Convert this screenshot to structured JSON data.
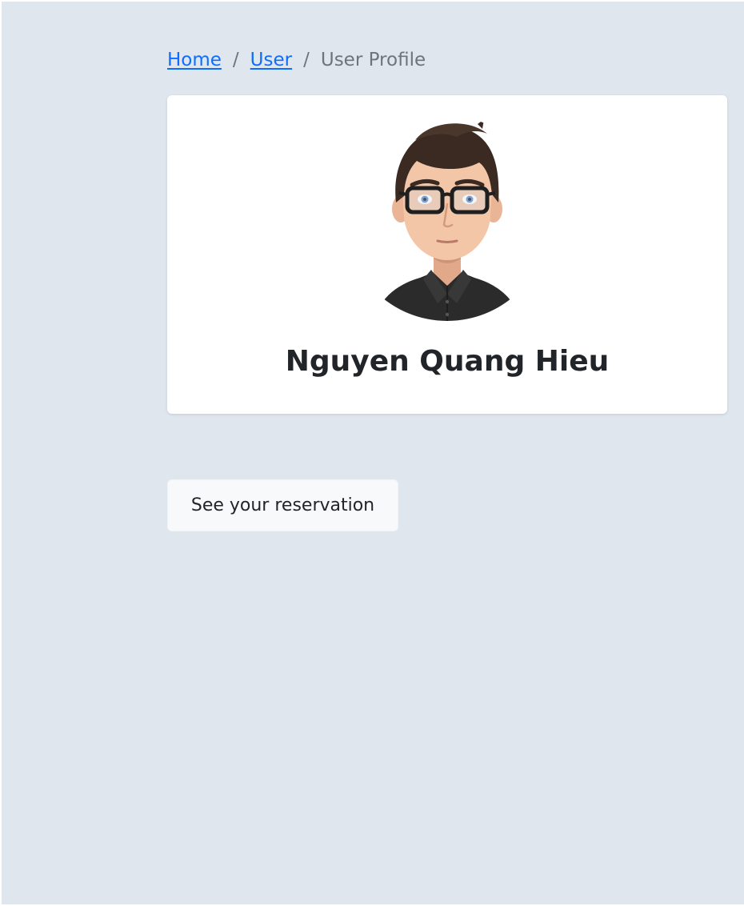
{
  "breadcrumb": {
    "items": [
      {
        "label": "Home",
        "link": true
      },
      {
        "label": "User",
        "link": true
      },
      {
        "label": "User Profile",
        "link": false
      }
    ],
    "separator": "/"
  },
  "profile": {
    "name": "Nguyen Quang Hieu",
    "avatar_icon": "user-avatar-cartoon"
  },
  "actions": {
    "reservation_label": "See your reservation"
  },
  "colors": {
    "background": "#e0e6ee",
    "link": "#0d6efd",
    "card": "#ffffff",
    "text": "#212529",
    "muted": "#6c757d"
  }
}
